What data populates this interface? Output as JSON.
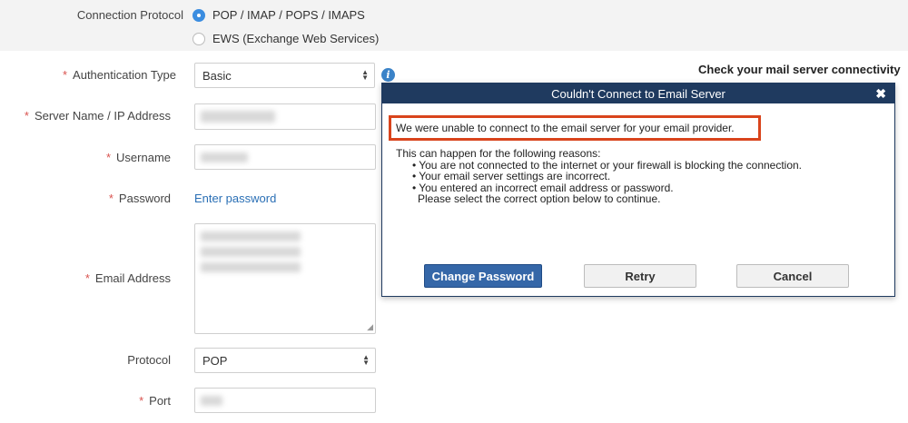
{
  "form": {
    "connection_protocol_label": "Connection Protocol",
    "protocol_options": [
      "POP / IMAP / POPS / IMAPS",
      "EWS (Exchange Web Services)"
    ],
    "selected_protocol_index": 0,
    "authentication_type_label": "Authentication Type",
    "authentication_type_value": "Basic",
    "server_name_label": "Server Name / IP Address",
    "username_label": "Username",
    "password_label": "Password",
    "password_link": "Enter password",
    "email_address_label": "Email Address",
    "protocol_label": "Protocol",
    "protocol_value": "POP",
    "port_label": "Port",
    "required_marker": "*"
  },
  "side_panel": {
    "title": "Check your mail server connectivity"
  },
  "dialog": {
    "title": "Couldn't Connect to Email Server",
    "close_glyph": "✖",
    "message": "We were unable to connect to the email server for your email provider.",
    "reasons_intro": "This can happen for the following reasons:",
    "reasons": [
      "You are not connected to the internet or your firewall is blocking the connection.",
      "Your email server settings are incorrect.",
      "You entered an incorrect email address or password."
    ],
    "instruction": "Please select the correct option below to continue.",
    "buttons": {
      "change_password": "Change Password",
      "retry": "Retry",
      "cancel": "Cancel"
    }
  },
  "colors": {
    "accent": "#3b8de0",
    "required": "#d9534f",
    "dialog_title_bg": "#1f3a5f",
    "highlight_border": "#d9441c",
    "primary_button": "#3567a8",
    "link": "#2a6fb5"
  },
  "icons": {
    "info": "info-icon",
    "select_arrows": "select-arrows-icon",
    "close": "close-icon"
  }
}
